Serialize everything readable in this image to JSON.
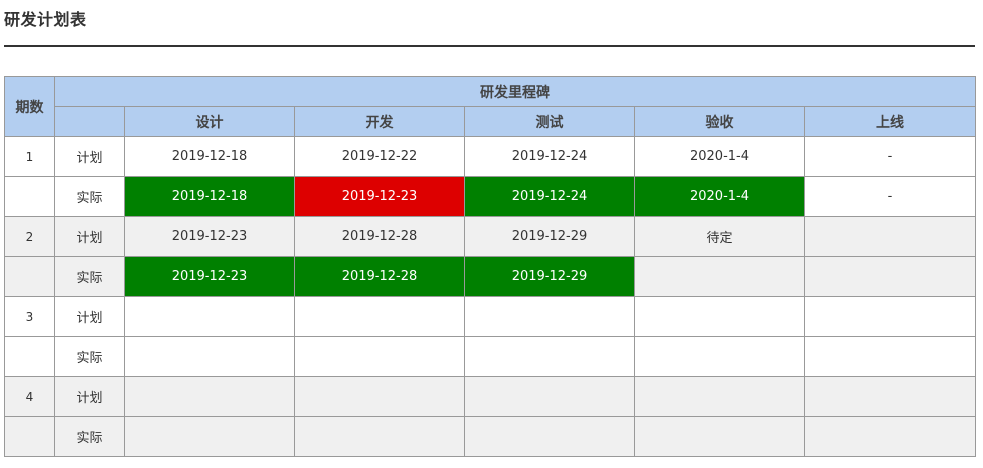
{
  "title": "研发计划表",
  "colors": {
    "header_bg": "#b3cef0",
    "on_time": "#008000",
    "late": "#dd0000",
    "shaded_row": "#f0f0f0"
  },
  "table": {
    "period_header": "期数",
    "milestone_header": "研发里程碑",
    "stages": [
      "设计",
      "开发",
      "测试",
      "验收",
      "上线"
    ],
    "rows": [
      {
        "period": "1",
        "type": "计划",
        "cells": [
          "2019-12-18",
          "2019-12-22",
          "2019-12-24",
          "2020-1-4",
          "-"
        ],
        "status": [
          "",
          "",
          "",
          "",
          ""
        ]
      },
      {
        "period": "",
        "type": "实际",
        "cells": [
          "2019-12-18",
          "2019-12-23",
          "2019-12-24",
          "2020-1-4",
          "-"
        ],
        "status": [
          "ok",
          "late",
          "ok",
          "ok",
          ""
        ]
      },
      {
        "period": "2",
        "type": "计划",
        "cells": [
          "2019-12-23",
          "2019-12-28",
          "2019-12-29",
          "待定",
          ""
        ],
        "status": [
          "",
          "",
          "",
          "",
          ""
        ]
      },
      {
        "period": "",
        "type": "实际",
        "cells": [
          "2019-12-23",
          "2019-12-28",
          "2019-12-29",
          "",
          ""
        ],
        "status": [
          "ok",
          "ok",
          "ok",
          "",
          ""
        ]
      },
      {
        "period": "3",
        "type": "计划",
        "cells": [
          "",
          "",
          "",
          "",
          ""
        ],
        "status": [
          "",
          "",
          "",
          "",
          ""
        ]
      },
      {
        "period": "",
        "type": "实际",
        "cells": [
          "",
          "",
          "",
          "",
          ""
        ],
        "status": [
          "",
          "",
          "",
          "",
          ""
        ]
      },
      {
        "period": "4",
        "type": "计划",
        "cells": [
          "",
          "",
          "",
          "",
          ""
        ],
        "status": [
          "",
          "",
          "",
          "",
          ""
        ]
      },
      {
        "period": "",
        "type": "实际",
        "cells": [
          "",
          "",
          "",
          "",
          ""
        ],
        "status": [
          "",
          "",
          "",
          "",
          ""
        ]
      }
    ]
  }
}
